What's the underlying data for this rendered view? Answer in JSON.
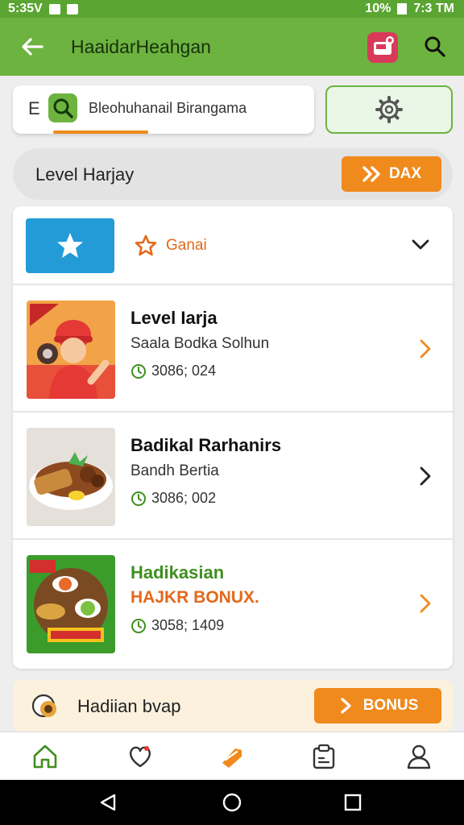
{
  "status_bar": {
    "time_left": "5:35V",
    "battery": "10%",
    "time_right": "7:3 TM"
  },
  "app_bar": {
    "title": "HaaidarHeahgan"
  },
  "search": {
    "prefix": "E",
    "text": "Bleohuhanail Birangama"
  },
  "level_banner": {
    "label": "Level Harjay",
    "button_label": "DAX"
  },
  "category": {
    "label": "Ganai"
  },
  "items": [
    {
      "title": "Level Iarja",
      "subtitle": "Saala Bodka Solhun",
      "meta": "3086; 024",
      "title_color": "#111111"
    },
    {
      "title": "Badikal Rarhanirs",
      "subtitle": "Bandh Bertia",
      "meta": "3086; 002",
      "title_color": "#111111"
    },
    {
      "title": "Hadikasian",
      "subtitle": "HAJKR BONUX.",
      "meta": "3058; 1409",
      "title_color": "#3f8f1f"
    }
  ],
  "bonus_strip": {
    "label": "Hadiian bvap",
    "button_label": "BONUS"
  },
  "colors": {
    "brand_green": "#6db33f",
    "accent_orange": "#f08a1c",
    "blue": "#239bd7"
  },
  "bottom_nav": {
    "icons": [
      "home-icon",
      "heart-icon",
      "tag-icon",
      "clipboard-icon",
      "profile-icon"
    ],
    "active_index": 2
  }
}
